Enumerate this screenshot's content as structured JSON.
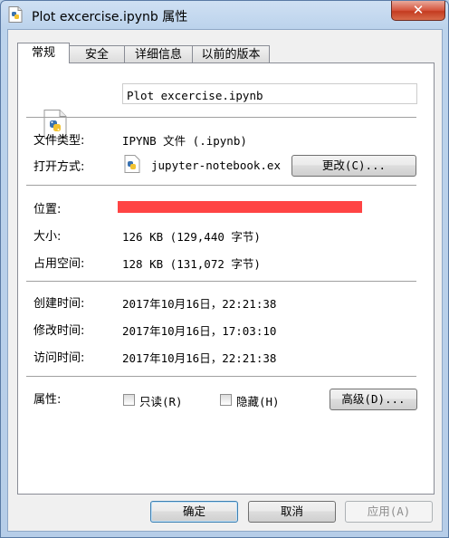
{
  "window": {
    "title": "Plot excercise.ipynb 属性",
    "close_glyph": "✕"
  },
  "tabs": [
    {
      "label": "常规",
      "active": true
    },
    {
      "label": "安全",
      "active": false
    },
    {
      "label": "详细信息",
      "active": false
    },
    {
      "label": "以前的版本",
      "active": false
    }
  ],
  "general": {
    "file_name": "Plot excercise.ipynb",
    "type_label": "文件类型:",
    "type_value": "IPYNB 文件 (.ipynb)",
    "opens_with_label": "打开方式:",
    "opens_with_value": "jupyter-notebook.ex",
    "change_button": "更改(C)...",
    "location_label": "位置:",
    "size_label": "大小:",
    "size_value": "126 KB (129,440 字节)",
    "disk_size_label": "占用空间:",
    "disk_size_value": "128 KB (131,072 字节)",
    "created_label": "创建时间:",
    "created_value": "2017年10月16日，22:21:38",
    "modified_label": "修改时间:",
    "modified_value": "2017年10月16日，17:03:10",
    "accessed_label": "访问时间:",
    "accessed_value": "2017年10月16日，22:21:38",
    "attributes_label": "属性:",
    "readonly_label": "只读(R)",
    "hidden_label": "隐藏(H)",
    "advanced_button": "高级(D)..."
  },
  "footer": {
    "ok_button": "确定",
    "cancel_button": "取消",
    "apply_button": "应用(A)"
  },
  "colors": {
    "redaction": "#ff4444",
    "close_button": "#c43b20"
  }
}
